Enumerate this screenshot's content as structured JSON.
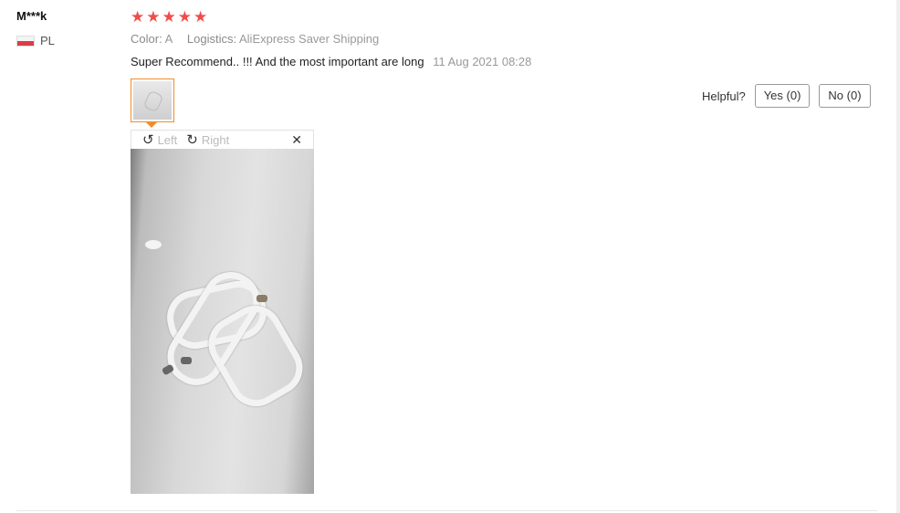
{
  "reviewer": {
    "name": "M***k",
    "country": "PL"
  },
  "rating": {
    "stars": 5,
    "max": 5,
    "star_glyph": "★",
    "color": "#f04c4c"
  },
  "meta": {
    "color_label": "Color:",
    "color_value": "A",
    "logistics_label": "Logistics:",
    "logistics_value": "AliExpress Saver Shipping"
  },
  "review": {
    "text": "Super Recommend.. !!! And the most important are long",
    "date": "11 Aug 2021 08:28"
  },
  "viewer": {
    "rotate_left_label": "Left",
    "rotate_right_label": "Right",
    "close_glyph": "✕",
    "rotate_left_icon": "↺",
    "rotate_right_icon": "↻"
  },
  "helpful": {
    "label": "Helpful?",
    "yes_label": "Yes (0)",
    "no_label": "No (0)"
  },
  "colors": {
    "accent": "#f08c2c"
  }
}
